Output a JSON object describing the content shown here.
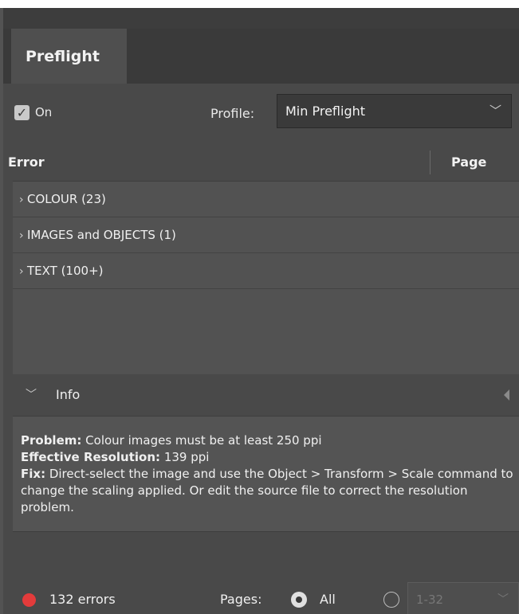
{
  "panel": {
    "tab": "Preflight"
  },
  "controls": {
    "on_label": "On",
    "profile_label": "Profile:",
    "profile_value": "Min Preflight"
  },
  "columns": {
    "error": "Error",
    "page": "Page"
  },
  "errors": [
    {
      "label": "COLOUR (23)"
    },
    {
      "label": "IMAGES and OBJECTS (1)"
    },
    {
      "label": "TEXT (100+)"
    }
  ],
  "info": {
    "title": "Info",
    "problem_label": "Problem:",
    "problem_text": "Colour images must be at least 250 ppi",
    "res_label": "Effective Resolution:",
    "res_text": "139 ppi",
    "fix_label": "Fix:",
    "fix_text": "Direct-select the image and use the Object > Transform > Scale command to change the scaling applied. Or edit the source file to correct the resolution problem."
  },
  "footer": {
    "error_count": "132 errors",
    "pages_label": "Pages:",
    "all_label": "All",
    "range_placeholder": "1-32"
  },
  "colors": {
    "error_dot": "#e33b3b",
    "panel_bg": "#494949"
  }
}
